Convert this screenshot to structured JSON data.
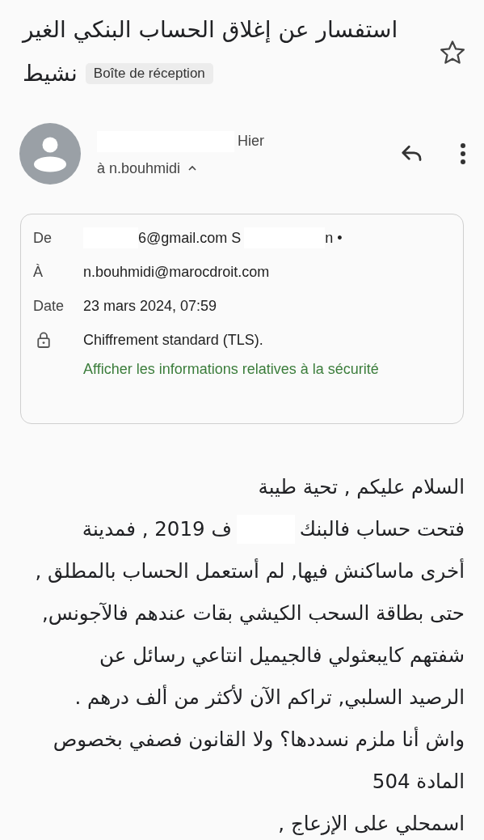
{
  "subject": {
    "lines": [
      "استفسار عن إغلاق الحساب البنكي الغير",
      "نشيط"
    ],
    "label": "Boîte de réception",
    "starred": false
  },
  "message": {
    "time": "Hier",
    "recipient": "à n.bouhmidi",
    "expanded": true
  },
  "details": {
    "rows": [
      {
        "kind": "from",
        "label": "De",
        "address": "6@gmail.com S",
        "name": "n •"
      },
      {
        "kind": "text",
        "label": "À",
        "value": "n.bouhmidi@marocdroit.com"
      },
      {
        "kind": "text",
        "label": "Date",
        "value": "23 mars 2024, 07:59"
      },
      {
        "kind": "security",
        "value": "Chiffrement standard (TLS).",
        "link": "Afficher les informations relatives à la sécurité"
      }
    ]
  },
  "body": [
    [
      "السلام عليكم , تحية طيبة"
    ],
    [
      "فتحت حساب فالبنك",
      "ف 2019 , فمدينة"
    ],
    [
      "أخرى ماساكنش فيها, لم أستعمل الحساب بالمطلق ,"
    ],
    [
      "حتى بطاقة السحب الكيشي بقات عندهم فالآجونس,"
    ],
    [
      "شفتهم كايبعثولي فالجيميل انتاعي رسائل عن"
    ],
    [
      "الرصيد السلبي, تراكم الآن لأكثر من ألف درهم ."
    ],
    [
      "واش أنا ملزم نسددها؟ ولا القانون فصفي بخصوص"
    ],
    [
      "المادة 504"
    ],
    [
      "اسمحلي على الإزعاج ,"
    ]
  ]
}
